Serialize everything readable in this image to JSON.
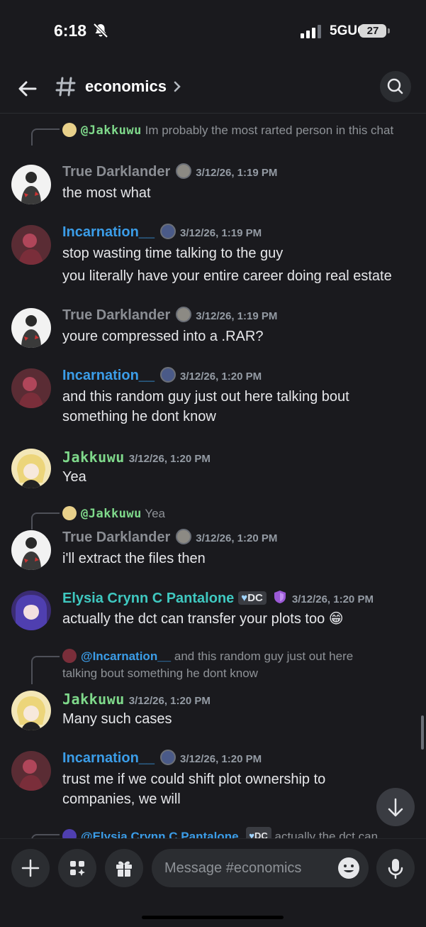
{
  "status_bar": {
    "time": "6:18",
    "network": "5GUC",
    "battery": "27"
  },
  "header": {
    "channel": "economics"
  },
  "messages": [
    {
      "reply_mention": "@Jakkuwu",
      "reply_text": "Im probably the most rarted person in this chat"
    },
    {
      "author": "True Darklander",
      "timestamp": "3/12/26, 1:19 PM",
      "lines": [
        "the most what"
      ]
    },
    {
      "author": "Incarnation__",
      "timestamp": "3/12/26, 1:19 PM",
      "lines": [
        "stop wasting time talking to the guy",
        "you literally have your entire career doing real estate"
      ]
    },
    {
      "author": "True Darklander",
      "timestamp": "3/12/26, 1:19 PM",
      "lines": [
        "youre compressed into a .RAR?"
      ]
    },
    {
      "author": "Incarnation__",
      "timestamp": "3/12/26, 1:20 PM",
      "lines": [
        "and this random guy just out here talking bout",
        "something he dont know"
      ]
    },
    {
      "author": "Jakkuwu",
      "timestamp": "3/12/26, 1:20 PM",
      "lines": [
        "Yea"
      ]
    },
    {
      "reply_mention": "@Jakkuwu",
      "reply_text": "Yea"
    },
    {
      "author": "True Darklander",
      "timestamp": "3/12/26, 1:20 PM",
      "lines": [
        "i'll extract the files then"
      ]
    },
    {
      "author": "Elysia Crynn C Pantalone",
      "tag": "DC",
      "timestamp": "3/12/26, 1:20 PM",
      "lines": [
        "actually the dct can transfer your plots too 😁"
      ]
    },
    {
      "reply_mention": "@Incarnation__",
      "reply_text": "and this random guy just out here",
      "reply_text2": "talking bout something he dont know"
    },
    {
      "author": "Jakkuwu",
      "timestamp": "3/12/26, 1:20 PM",
      "lines": [
        "Many such cases"
      ]
    },
    {
      "author": "Incarnation__",
      "timestamp": "3/12/26, 1:20 PM",
      "lines": [
        "trust me if we could shift plot ownership to",
        "companies, we will"
      ]
    },
    {
      "reply_mention": "@Elysia Crynn C Pantalone",
      "tag": "DC",
      "reply_text": "actually the dct can"
    }
  ],
  "composer": {
    "placeholder": "Message #economics"
  },
  "colors": {
    "background": "#1a1a1e",
    "accent_blue": "#3b9de8",
    "green_name": "#7fd98b",
    "teal_name": "#3fc8c0"
  }
}
